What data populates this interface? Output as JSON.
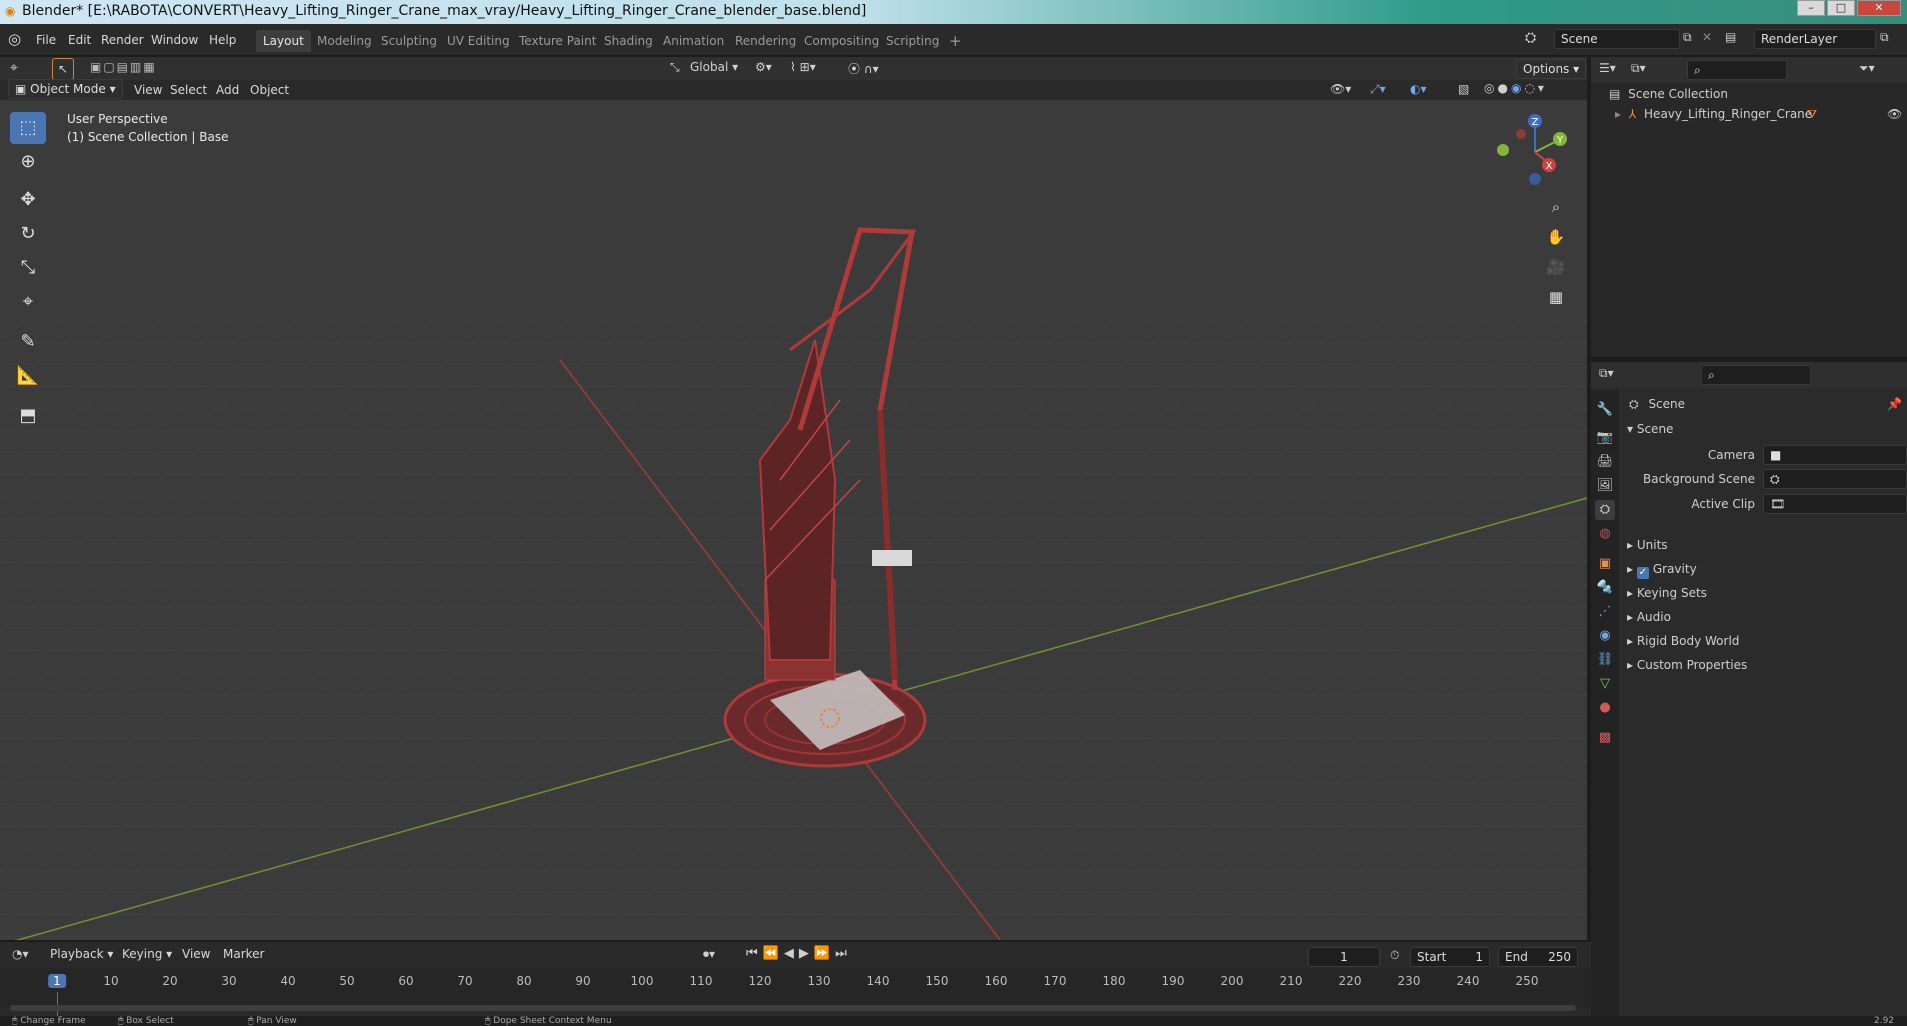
{
  "window": {
    "title": "Blender* [E:\\RABOTA\\CONVERT\\Heavy_Lifting_Ringer_Crane_max_vray/Heavy_Lifting_Ringer_Crane_blender_base.blend]",
    "minimize": "–",
    "maximize": "□",
    "close": "✕"
  },
  "menu": [
    "File",
    "Edit",
    "Render",
    "Window",
    "Help"
  ],
  "workspaces": [
    "Layout",
    "Modeling",
    "Sculpting",
    "UV Editing",
    "Texture Paint",
    "Shading",
    "Animation",
    "Rendering",
    "Compositing",
    "Scripting"
  ],
  "scene_field": "Scene",
  "renderlayer_field": "RenderLayer",
  "header": {
    "transform_orientation": "Global",
    "options": "Options"
  },
  "viewport_header": {
    "mode": "Object Mode",
    "menus": [
      "View",
      "Select",
      "Add",
      "Object"
    ]
  },
  "viewport": {
    "perspective": "User Perspective",
    "collection": "(1) Scene Collection | Base"
  },
  "gizmo": {
    "x": "X",
    "y": "Y",
    "z": "Z"
  },
  "outliner": {
    "root": "Scene Collection",
    "items": [
      "Heavy_Lifting_Ringer_Crane"
    ]
  },
  "properties": {
    "context_title": "Scene",
    "panel_title": "Scene",
    "fields": [
      {
        "label": "Camera"
      },
      {
        "label": "Background Scene"
      },
      {
        "label": "Active Clip"
      }
    ],
    "panels": [
      "Units",
      "Gravity",
      "Keying Sets",
      "Audio",
      "Rigid Body World",
      "Custom Properties"
    ]
  },
  "timeline": {
    "menus": [
      "Playback",
      "Keying",
      "View",
      "Marker"
    ],
    "current_frame": "1",
    "start_label": "Start",
    "start": "1",
    "end_label": "End",
    "end": "250",
    "ticks": [
      "1",
      "10",
      "20",
      "30",
      "40",
      "50",
      "60",
      "70",
      "80",
      "90",
      "100",
      "110",
      "120",
      "130",
      "140",
      "150",
      "160",
      "170",
      "180",
      "190",
      "200",
      "210",
      "220",
      "230",
      "240",
      "250"
    ]
  },
  "statusbar": [
    "Change Frame",
    "Box Select",
    "Pan View",
    "Dope Sheet Context Menu"
  ],
  "version": "2.92"
}
